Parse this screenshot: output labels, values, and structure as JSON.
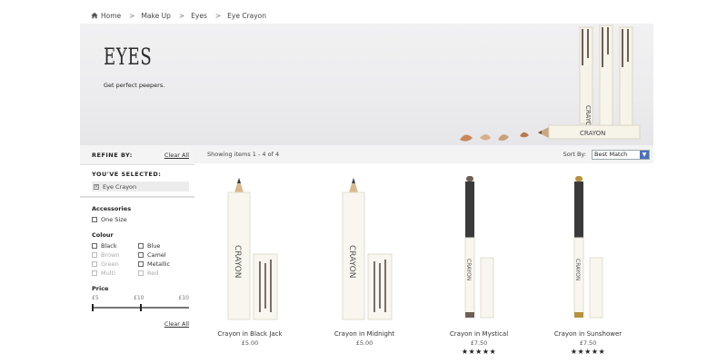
{
  "breadcrumb": {
    "home": "Home",
    "items": [
      "Make Up",
      "Eyes",
      "Eye Crayon"
    ],
    "separator": ">"
  },
  "hero": {
    "title": "EYES",
    "subtitle": "Get perfect peepers.",
    "pencil_label": "CRAYON"
  },
  "sidebar": {
    "refine_label": "REFINE BY:",
    "clear_all": "Clear All",
    "selected_title": "YOU'VE SELECTED:",
    "selected_item": "Eye Crayon",
    "accessories": {
      "title": "Accessories",
      "options": [
        {
          "label": "One Size",
          "enabled": true
        }
      ]
    },
    "colour": {
      "title": "Colour",
      "options": [
        {
          "label": "Black",
          "enabled": true
        },
        {
          "label": "Blue",
          "enabled": true
        },
        {
          "label": "Brown",
          "enabled": false
        },
        {
          "label": "Camel",
          "enabled": true
        },
        {
          "label": "Green",
          "enabled": false
        },
        {
          "label": "Metallic",
          "enabled": true
        },
        {
          "label": "Multi",
          "enabled": false
        },
        {
          "label": "Red",
          "enabled": false
        }
      ]
    },
    "price": {
      "title": "Price",
      "labels": [
        "£5",
        "£10",
        "£10"
      ],
      "range_low_fraction": 0.0,
      "range_high_fraction": 0.5
    },
    "clear_all_bottom": "Clear All"
  },
  "toolbar": {
    "showing": "Showing items 1 - 4 of 4",
    "sort_label": "Sort By:",
    "sort_value": "Best Match"
  },
  "products": [
    {
      "name": "Crayon in Black Jack",
      "price": "£5.00",
      "stars": "",
      "type": "pencil",
      "tip": "#3a3a3a"
    },
    {
      "name": "Crayon in Midnight",
      "price": "£5.00",
      "stars": "",
      "type": "pencil",
      "tip": "#3f4656"
    },
    {
      "name": "Crayon in Mystical",
      "price": "£7.50",
      "stars": "★★★★★",
      "type": "stick",
      "tip": "#6e5f54"
    },
    {
      "name": "Crayon in Sunshower",
      "price": "£7.50",
      "stars": "★★★★★",
      "type": "stick",
      "tip": "#b8913c"
    }
  ],
  "colors": {
    "accent_select": "#4b6fc4",
    "hero_bg": "#ececee"
  }
}
